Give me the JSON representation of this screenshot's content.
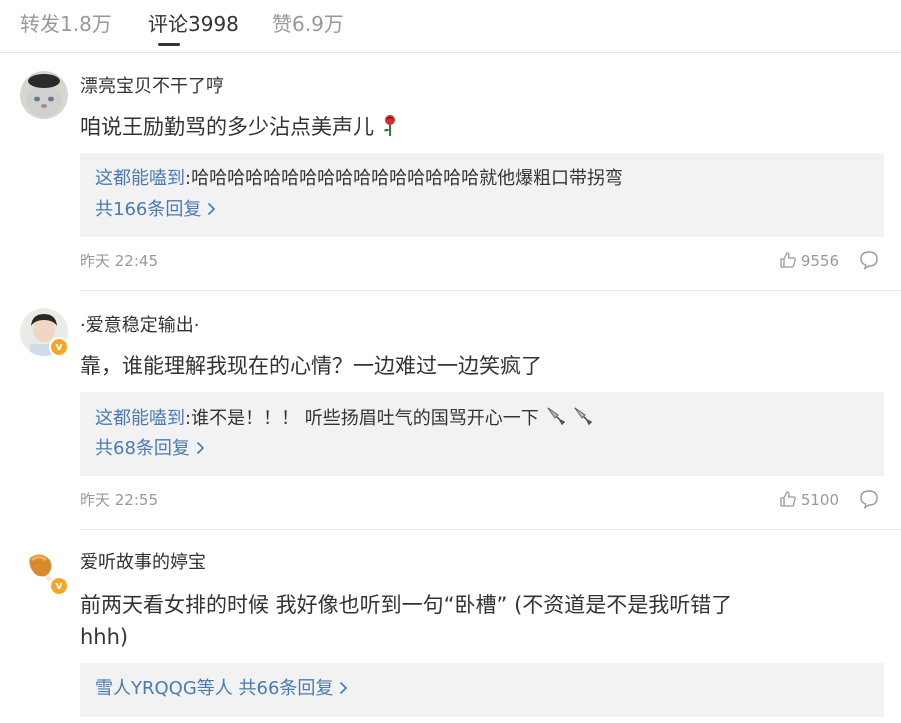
{
  "tabs": [
    {
      "label": "转发1.8万",
      "active": false
    },
    {
      "label": "评论3998",
      "active": true
    },
    {
      "label": "赞6.9万",
      "active": false
    }
  ],
  "comments": [
    {
      "username": "漂亮宝贝不干了哼",
      "text": "咱说王励勤骂的多少沾点美声儿",
      "emoji": "rose",
      "reply_user": "这都能嗑到",
      "reply_text": ":哈哈哈哈哈哈哈哈哈哈哈哈哈哈哈哈就他爆粗口带拐弯",
      "reply_count": "共166条回复",
      "time": "昨天 22:45",
      "likes": "9556"
    },
    {
      "username": "·爱意稳定输出·",
      "text": "靠，谁能理解我现在的心情？一边难过一边笑疯了",
      "reply_user": "这都能嗑到",
      "reply_text": ":谁不是！！！ 听些扬眉吐气的国骂开心一下",
      "reply_count": "共68条回复",
      "time": "昨天 22:55",
      "likes": "5100",
      "verified": true
    },
    {
      "username": "爱听故事的婷宝",
      "text_line1": "前两天看女排的时候 我好像也听到一句“卧槽” (不资道是不是我听错了",
      "text_line2": "hhh)",
      "reply_summary_user": "雪人YRQQG等人",
      "reply_summary_count": "共66条回复",
      "verified": true
    }
  ],
  "colors": {
    "link": "#4a7ab3",
    "muted": "#999999",
    "reply_bg": "#f2f2f2",
    "badge": "#f5a623"
  }
}
